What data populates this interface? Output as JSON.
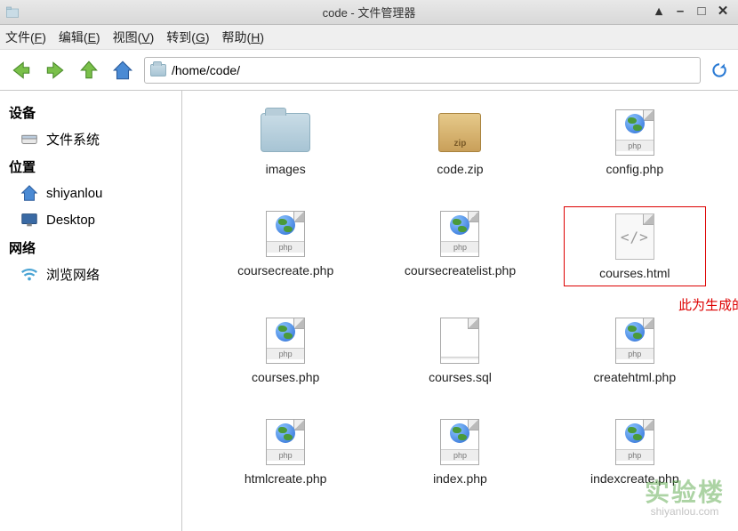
{
  "window": {
    "title": "code - 文件管理器"
  },
  "menu": {
    "file": {
      "pre": "文件(",
      "key": "F",
      "post": ")"
    },
    "edit": {
      "pre": "编辑(",
      "key": "E",
      "post": ")"
    },
    "view": {
      "pre": "视图(",
      "key": "V",
      "post": ")"
    },
    "go": {
      "pre": "转到(",
      "key": "G",
      "post": ")"
    },
    "help": {
      "pre": "帮助(",
      "key": "H",
      "post": ")"
    }
  },
  "path": "/home/code/",
  "sidebar": {
    "devices_header": "设备",
    "filesystem": "文件系统",
    "places_header": "位置",
    "home": "shiyanlou",
    "desktop": "Desktop",
    "network_header": "网络",
    "browse_network": "浏览网络"
  },
  "files": {
    "f0": {
      "label": "images",
      "type": "folder"
    },
    "f1": {
      "label": "code.zip",
      "type": "zip"
    },
    "f2": {
      "label": "config.php",
      "type": "php"
    },
    "f3": {
      "label": "coursecreate.php",
      "type": "php"
    },
    "f4": {
      "label": "coursecreatelist.php",
      "type": "php"
    },
    "f5": {
      "label": "courses.html",
      "type": "html",
      "highlighted": true
    },
    "f6": {
      "label": "courses.php",
      "type": "php"
    },
    "f7": {
      "label": "courses.sql",
      "type": "sql"
    },
    "f8": {
      "label": "createhtml.php",
      "type": "php"
    },
    "f9": {
      "label": "htmlcreate.php",
      "type": "php"
    },
    "f10": {
      "label": "index.php",
      "type": "php"
    },
    "f11": {
      "label": "indexcreate.php",
      "type": "php"
    }
  },
  "annotation": "此为生成的静态文件",
  "watermark": {
    "zh": "实验楼",
    "en": "shiyanlou.com"
  }
}
